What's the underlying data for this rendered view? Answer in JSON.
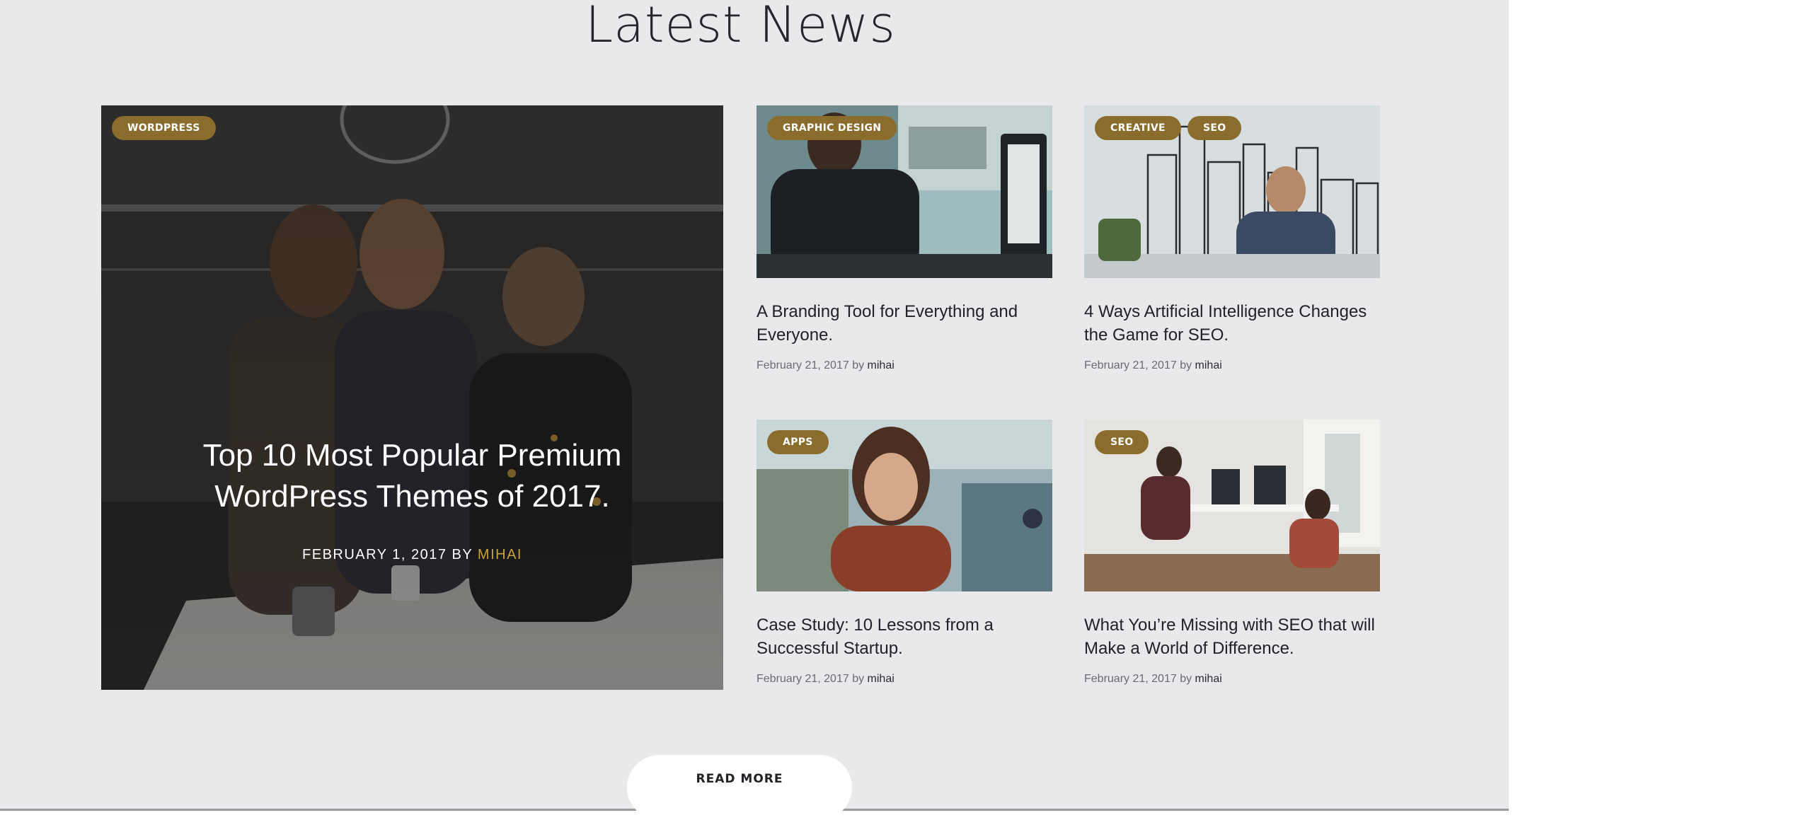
{
  "section": {
    "title": "Latest News"
  },
  "featured": {
    "tag": "WORDPRESS",
    "title_line1": "Top 10 Most Popular Premium",
    "title_line2": "WordPress Themes of 2017.",
    "date_by": "February 1, 2017 by",
    "author": "mihai"
  },
  "posts": [
    {
      "tags": [
        "GRAPHIC DESIGN"
      ],
      "title": "A Branding Tool for Everything and Everyone.",
      "date_by": "February 21, 2017 by",
      "author": "mihai"
    },
    {
      "tags": [
        "CREATIVE",
        "SEO"
      ],
      "title": "4 Ways Artificial Intelligence Changes the Game for SEO.",
      "date_by": "February 21, 2017 by",
      "author": "mihai"
    },
    {
      "tags": [
        "APPS"
      ],
      "title": "Case Study: 10 Lessons from a Successful Startup.",
      "date_by": "February 21, 2017 by",
      "author": "mihai"
    },
    {
      "tags": [
        "SEO"
      ],
      "title": "What You’re Missing with SEO that will Make a World of Difference.",
      "date_by": "February 21, 2017 by",
      "author": "mihai"
    }
  ],
  "read_more": {
    "label": "READ MORE"
  },
  "colors": {
    "background": "#e9e9ec",
    "tag": "#8a6d2d",
    "author_highlight": "#c9a13a"
  }
}
